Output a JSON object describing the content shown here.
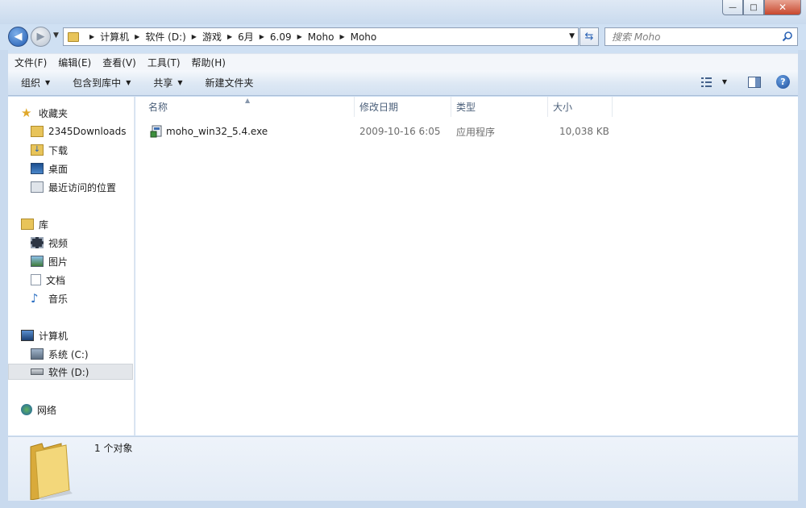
{
  "window": {
    "minimize_glyph": "—",
    "maximize_glyph": "□",
    "close_glyph": "✕"
  },
  "address_bar": {
    "crumbs": [
      "计算机",
      "软件 (D:)",
      "游戏",
      "6月",
      "6.09",
      "Moho",
      "Moho"
    ]
  },
  "search": {
    "placeholder": "搜索 Moho"
  },
  "menu": {
    "items": [
      "文件(F)",
      "编辑(E)",
      "查看(V)",
      "工具(T)",
      "帮助(H)"
    ]
  },
  "command_bar": {
    "organize": "组织",
    "include_library": "包含到库中",
    "share": "共享",
    "new_folder": "新建文件夹"
  },
  "sidebar": {
    "favorites": "收藏夹",
    "fav_items": [
      "2345Downloads",
      "下载",
      "桌面",
      "最近访问的位置"
    ],
    "libraries": "库",
    "lib_items": [
      "视频",
      "图片",
      "文档",
      "音乐"
    ],
    "computer": "计算机",
    "drives": [
      "系统 (C:)",
      "软件 (D:)"
    ],
    "network": "网络"
  },
  "file_list": {
    "columns": [
      "名称",
      "修改日期",
      "类型",
      "大小"
    ],
    "rows": [
      {
        "name": "moho_win32_5.4.exe",
        "modified": "2009-10-16 6:05",
        "type": "应用程序",
        "size": "10,038 KB"
      }
    ]
  },
  "details": {
    "count": "1 个对象"
  },
  "colors": {
    "frame": "#c9daee",
    "folder": "#e8c45a",
    "selection": "#e3e6ea"
  }
}
